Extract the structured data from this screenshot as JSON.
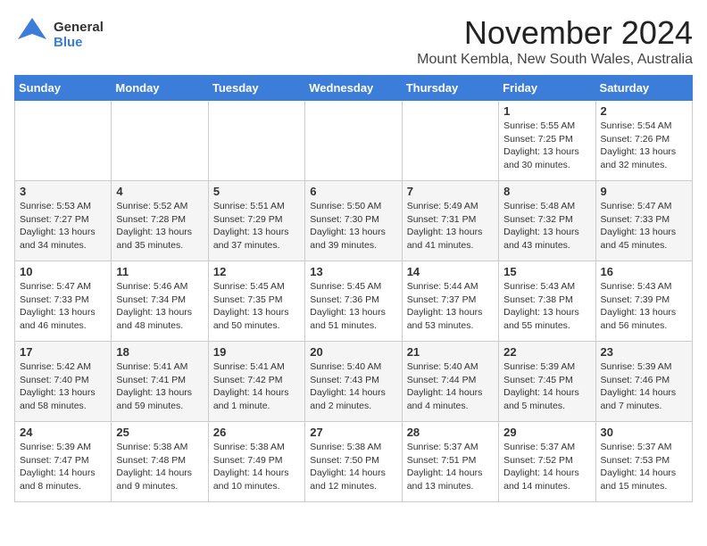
{
  "logo": {
    "general": "General",
    "blue": "Blue"
  },
  "title": "November 2024",
  "location": "Mount Kembla, New South Wales, Australia",
  "weekdays": [
    "Sunday",
    "Monday",
    "Tuesday",
    "Wednesday",
    "Thursday",
    "Friday",
    "Saturday"
  ],
  "weeks": [
    [
      {
        "day": "",
        "info": ""
      },
      {
        "day": "",
        "info": ""
      },
      {
        "day": "",
        "info": ""
      },
      {
        "day": "",
        "info": ""
      },
      {
        "day": "",
        "info": ""
      },
      {
        "day": "1",
        "info": "Sunrise: 5:55 AM\nSunset: 7:25 PM\nDaylight: 13 hours and 30 minutes."
      },
      {
        "day": "2",
        "info": "Sunrise: 5:54 AM\nSunset: 7:26 PM\nDaylight: 13 hours and 32 minutes."
      }
    ],
    [
      {
        "day": "3",
        "info": "Sunrise: 5:53 AM\nSunset: 7:27 PM\nDaylight: 13 hours and 34 minutes."
      },
      {
        "day": "4",
        "info": "Sunrise: 5:52 AM\nSunset: 7:28 PM\nDaylight: 13 hours and 35 minutes."
      },
      {
        "day": "5",
        "info": "Sunrise: 5:51 AM\nSunset: 7:29 PM\nDaylight: 13 hours and 37 minutes."
      },
      {
        "day": "6",
        "info": "Sunrise: 5:50 AM\nSunset: 7:30 PM\nDaylight: 13 hours and 39 minutes."
      },
      {
        "day": "7",
        "info": "Sunrise: 5:49 AM\nSunset: 7:31 PM\nDaylight: 13 hours and 41 minutes."
      },
      {
        "day": "8",
        "info": "Sunrise: 5:48 AM\nSunset: 7:32 PM\nDaylight: 13 hours and 43 minutes."
      },
      {
        "day": "9",
        "info": "Sunrise: 5:47 AM\nSunset: 7:33 PM\nDaylight: 13 hours and 45 minutes."
      }
    ],
    [
      {
        "day": "10",
        "info": "Sunrise: 5:47 AM\nSunset: 7:33 PM\nDaylight: 13 hours and 46 minutes."
      },
      {
        "day": "11",
        "info": "Sunrise: 5:46 AM\nSunset: 7:34 PM\nDaylight: 13 hours and 48 minutes."
      },
      {
        "day": "12",
        "info": "Sunrise: 5:45 AM\nSunset: 7:35 PM\nDaylight: 13 hours and 50 minutes."
      },
      {
        "day": "13",
        "info": "Sunrise: 5:45 AM\nSunset: 7:36 PM\nDaylight: 13 hours and 51 minutes."
      },
      {
        "day": "14",
        "info": "Sunrise: 5:44 AM\nSunset: 7:37 PM\nDaylight: 13 hours and 53 minutes."
      },
      {
        "day": "15",
        "info": "Sunrise: 5:43 AM\nSunset: 7:38 PM\nDaylight: 13 hours and 55 minutes."
      },
      {
        "day": "16",
        "info": "Sunrise: 5:43 AM\nSunset: 7:39 PM\nDaylight: 13 hours and 56 minutes."
      }
    ],
    [
      {
        "day": "17",
        "info": "Sunrise: 5:42 AM\nSunset: 7:40 PM\nDaylight: 13 hours and 58 minutes."
      },
      {
        "day": "18",
        "info": "Sunrise: 5:41 AM\nSunset: 7:41 PM\nDaylight: 13 hours and 59 minutes."
      },
      {
        "day": "19",
        "info": "Sunrise: 5:41 AM\nSunset: 7:42 PM\nDaylight: 14 hours and 1 minute."
      },
      {
        "day": "20",
        "info": "Sunrise: 5:40 AM\nSunset: 7:43 PM\nDaylight: 14 hours and 2 minutes."
      },
      {
        "day": "21",
        "info": "Sunrise: 5:40 AM\nSunset: 7:44 PM\nDaylight: 14 hours and 4 minutes."
      },
      {
        "day": "22",
        "info": "Sunrise: 5:39 AM\nSunset: 7:45 PM\nDaylight: 14 hours and 5 minutes."
      },
      {
        "day": "23",
        "info": "Sunrise: 5:39 AM\nSunset: 7:46 PM\nDaylight: 14 hours and 7 minutes."
      }
    ],
    [
      {
        "day": "24",
        "info": "Sunrise: 5:39 AM\nSunset: 7:47 PM\nDaylight: 14 hours and 8 minutes."
      },
      {
        "day": "25",
        "info": "Sunrise: 5:38 AM\nSunset: 7:48 PM\nDaylight: 14 hours and 9 minutes."
      },
      {
        "day": "26",
        "info": "Sunrise: 5:38 AM\nSunset: 7:49 PM\nDaylight: 14 hours and 10 minutes."
      },
      {
        "day": "27",
        "info": "Sunrise: 5:38 AM\nSunset: 7:50 PM\nDaylight: 14 hours and 12 minutes."
      },
      {
        "day": "28",
        "info": "Sunrise: 5:37 AM\nSunset: 7:51 PM\nDaylight: 14 hours and 13 minutes."
      },
      {
        "day": "29",
        "info": "Sunrise: 5:37 AM\nSunset: 7:52 PM\nDaylight: 14 hours and 14 minutes."
      },
      {
        "day": "30",
        "info": "Sunrise: 5:37 AM\nSunset: 7:53 PM\nDaylight: 14 hours and 15 minutes."
      }
    ]
  ]
}
